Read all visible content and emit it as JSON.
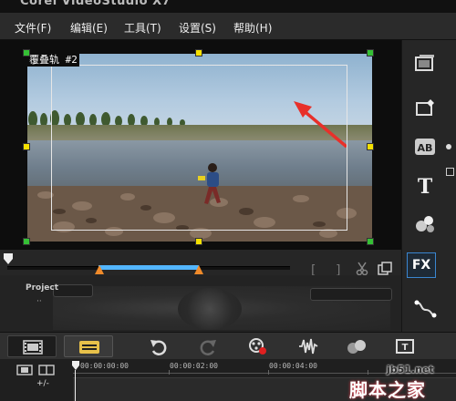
{
  "window": {
    "title": "Corel VideoStudio X7"
  },
  "menu": {
    "items": [
      {
        "label": "文件(F)"
      },
      {
        "label": "编辑(E)"
      },
      {
        "label": "工具(T)"
      },
      {
        "label": "设置(S)"
      },
      {
        "label": "帮助(H)"
      }
    ]
  },
  "preview": {
    "track_label": "覆叠轨 #2",
    "annotation_arrow_color": "#e8302a"
  },
  "right_tools": {
    "items": [
      {
        "icon": "media-icon"
      },
      {
        "icon": "instant-project-icon"
      },
      {
        "icon": "transition-icon"
      },
      {
        "icon": "title-icon"
      },
      {
        "icon": "graphic-icon"
      },
      {
        "icon": "filter-icon",
        "label": "FX"
      },
      {
        "icon": "path-icon"
      }
    ]
  },
  "controls": {
    "bracket_left": "[",
    "bracket_right": "]",
    "trim_color": "#53b6ff",
    "marker_color": "#f08a2a"
  },
  "lower": {
    "project_label": "Project",
    "project_sub": "··"
  },
  "timeline_toolbar": {
    "buttons": [
      {
        "icon": "storyboard-view-icon"
      },
      {
        "icon": "timeline-view-icon"
      },
      {
        "icon": "undo-icon"
      },
      {
        "icon": "redo-icon"
      },
      {
        "icon": "record-capture-icon"
      },
      {
        "icon": "sound-mixer-icon"
      },
      {
        "icon": "auto-music-icon"
      },
      {
        "icon": "subtitle-icon"
      }
    ]
  },
  "ruler": {
    "timecodes": [
      "00:00:00:00",
      "00:00:02:00",
      "00:00:04:00"
    ],
    "left_label": "+/-"
  },
  "watermark": {
    "site": "jb51.net",
    "brand": "脚本之家"
  }
}
